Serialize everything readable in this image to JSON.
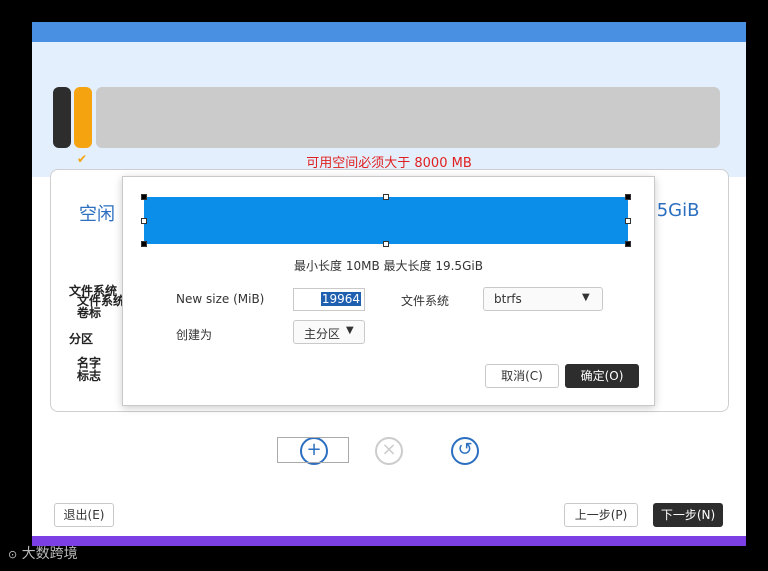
{
  "warning": "可用空间必须大于 8000 MB",
  "panel": {
    "free_label": "空闲",
    "free_size": ".5GiB",
    "labels": [
      "文件系统",
      "文件系统",
      "卷标",
      "分区",
      "名字",
      "标志"
    ]
  },
  "dialog": {
    "range_info": "最小长度 10MB  最大长度 19.5GiB",
    "size_label": "New size (MiB)",
    "size_value": "19964",
    "fs_label": "文件系统",
    "fs_value": "btrfs",
    "create_label": "创建为",
    "create_value": "主分区",
    "cancel": "取消(C)",
    "ok": "确定(O)"
  },
  "footer": {
    "quit": "退出(E)",
    "prev": "上一步(P)",
    "next": "下一步(N)"
  },
  "watermark": "大数跨境",
  "icons": [
    "check-icon",
    "add-icon",
    "remove-icon",
    "revert-icon",
    "chevron-down-icon"
  ],
  "colors": {
    "accent": "#0a8eea",
    "warning": "#e02020",
    "orange": "#f5a30e",
    "purple": "#7b3fe4"
  }
}
